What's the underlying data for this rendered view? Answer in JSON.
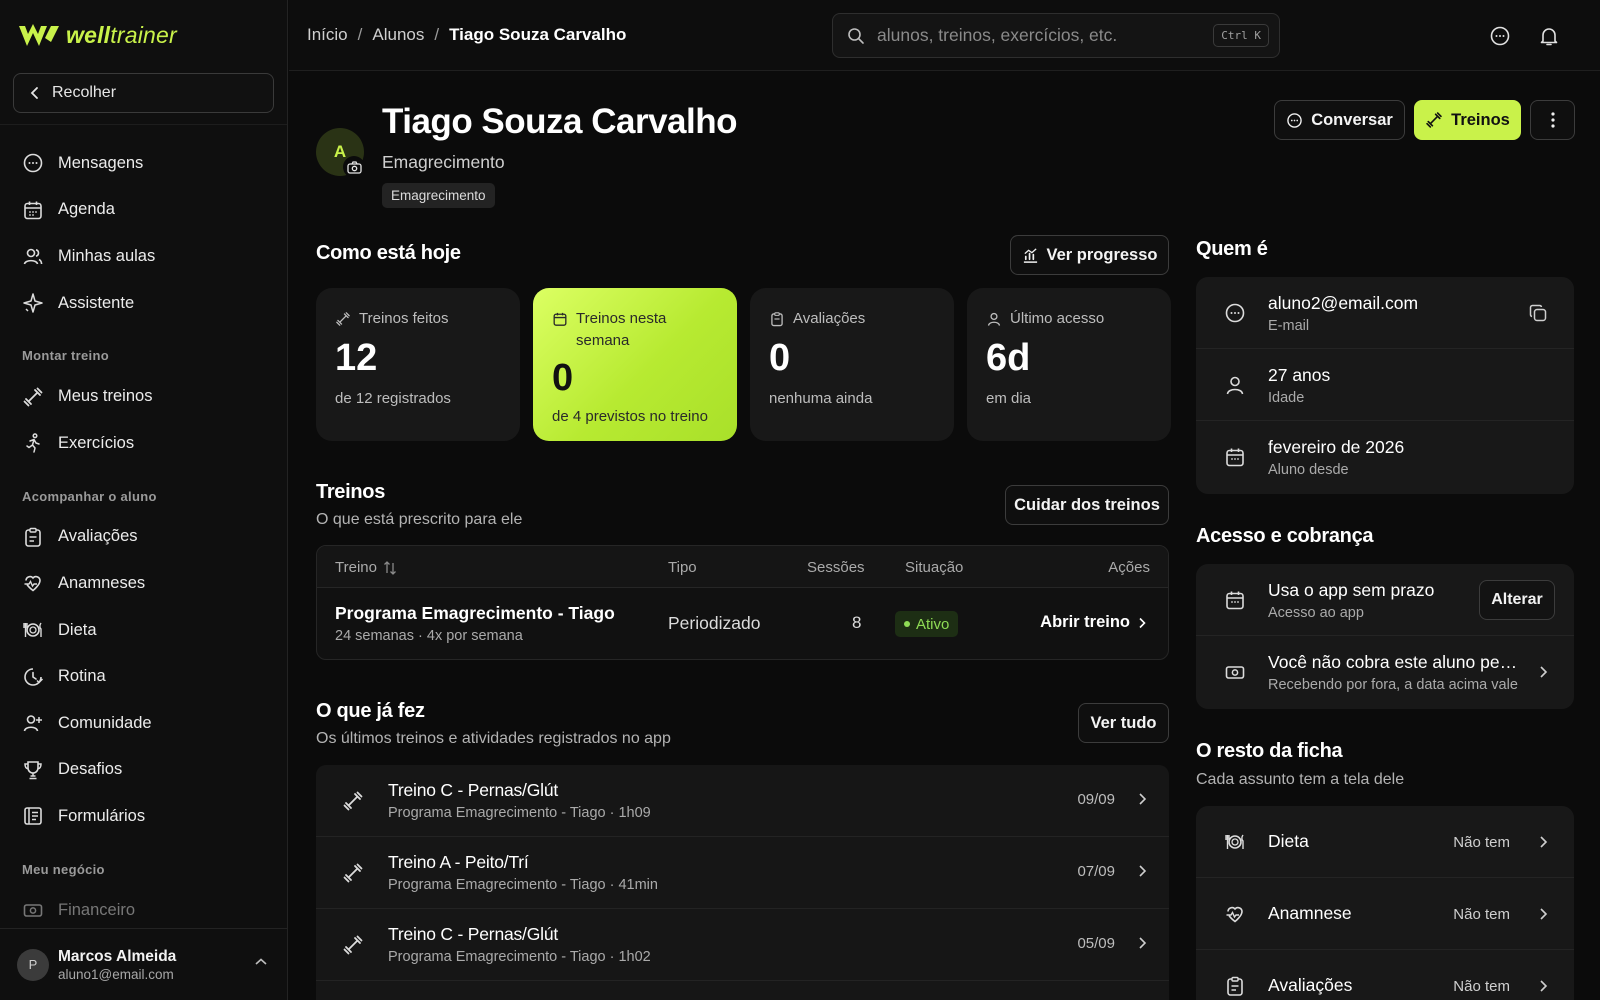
{
  "app": {
    "logo_bold": "well",
    "logo_light": "trainer",
    "brand_color": "#c9f24a"
  },
  "sidebar": {
    "collapse_label": "Recolher",
    "items_top": [
      {
        "label": "Mensagens",
        "icon": "chat-icon"
      },
      {
        "label": "Agenda",
        "icon": "calendar-icon"
      },
      {
        "label": "Minhas aulas",
        "icon": "users-icon"
      },
      {
        "label": "Assistente",
        "icon": "sparkle-icon"
      }
    ],
    "section_montar": "Montar treino",
    "items_montar": [
      {
        "label": "Meus treinos",
        "icon": "dumbbell-icon"
      },
      {
        "label": "Exercícios",
        "icon": "running-icon"
      }
    ],
    "section_acompanhar": "Acompanhar o aluno",
    "items_acompanhar": [
      {
        "label": "Avaliações",
        "icon": "clipboard-icon"
      },
      {
        "label": "Anamneses",
        "icon": "heart-pulse-icon"
      },
      {
        "label": "Dieta",
        "icon": "plate-icon"
      },
      {
        "label": "Rotina",
        "icon": "clock-icon"
      },
      {
        "label": "Comunidade",
        "icon": "community-icon"
      },
      {
        "label": "Desafios",
        "icon": "trophy-icon"
      },
      {
        "label": "Formulários",
        "icon": "form-icon"
      }
    ],
    "section_negocio": "Meu negócio",
    "items_negocio": [
      {
        "label": "Financeiro",
        "icon": "cash-icon"
      }
    ],
    "user": {
      "initial": "P",
      "name": "Marcos Almeida",
      "email": "aluno1@email.com"
    }
  },
  "topbar": {
    "breadcrumb": [
      "Início",
      "Alunos",
      "Tiago Souza Carvalho"
    ],
    "search_placeholder": "alunos, treinos, exercícios, etc.",
    "search_shortcut": "Ctrl K"
  },
  "student": {
    "initial": "A",
    "name": "Tiago Souza Carvalho",
    "goal": "Emagrecimento",
    "tag": "Emagrecimento"
  },
  "actions": {
    "chat": "Conversar",
    "workouts": "Treinos"
  },
  "today": {
    "title": "Como está hoje",
    "progress_button": "Ver progresso",
    "stats": [
      {
        "label": "Treinos feitos",
        "value": "12",
        "sub": "de 12 registrados"
      },
      {
        "label": "Treinos nesta semana",
        "value": "0",
        "sub": "de 4 previstos no treino"
      },
      {
        "label": "Avaliações",
        "value": "0",
        "sub": "nenhuma ainda"
      },
      {
        "label": "Último acesso",
        "value": "6d",
        "sub": "em dia"
      }
    ]
  },
  "workouts": {
    "title": "Treinos",
    "subtitle": "O que está prescrito para ele",
    "manage_button": "Cuidar dos treinos",
    "columns": {
      "name": "Treino",
      "type": "Tipo",
      "sessions": "Sessões",
      "status": "Situação",
      "actions": "Ações"
    },
    "rows": [
      {
        "name": "Programa Emagrecimento - Tiago",
        "meta": "24 semanas · 4x por semana",
        "type": "Periodizado",
        "sessions": "8",
        "status": "Ativo",
        "action": "Abrir treino"
      }
    ]
  },
  "history": {
    "title": "O que já fez",
    "subtitle": "Os últimos treinos e atividades registrados no app",
    "see_all": "Ver tudo",
    "items": [
      {
        "title": "Treino C - Pernas/Glút",
        "meta": "Programa Emagrecimento - Tiago · 1h09",
        "date": "09/09"
      },
      {
        "title": "Treino A - Peito/Trí",
        "meta": "Programa Emagrecimento - Tiago · 41min",
        "date": "07/09"
      },
      {
        "title": "Treino C - Pernas/Glút",
        "meta": "Programa Emagrecimento - Tiago · 1h02",
        "date": "05/09"
      }
    ]
  },
  "who": {
    "title": "Quem é",
    "rows": [
      {
        "main": "aluno2@email.com",
        "sub": "E-mail",
        "icon": "chat-icon"
      },
      {
        "main": "27 anos",
        "sub": "Idade",
        "icon": "person-icon"
      },
      {
        "main": "fevereiro de 2026",
        "sub": "Aluno desde",
        "icon": "calendar-icon"
      }
    ]
  },
  "billing": {
    "title": "Acesso e cobrança",
    "access_main": "Usa o app sem prazo",
    "access_sub": "Acesso ao app",
    "change_button": "Alterar",
    "charge_main": "Você não cobra este aluno pelo app",
    "charge_sub": "Recebendo por fora, a data acima vale"
  },
  "record": {
    "title": "O resto da ficha",
    "subtitle": "Cada assunto tem a tela dele",
    "rows": [
      {
        "label": "Dieta",
        "status": "Não tem",
        "icon": "plate-icon"
      },
      {
        "label": "Anamnese",
        "status": "Não tem",
        "icon": "heart-pulse-icon"
      },
      {
        "label": "Avaliações",
        "status": "Não tem",
        "icon": "clipboard-icon"
      }
    ]
  }
}
